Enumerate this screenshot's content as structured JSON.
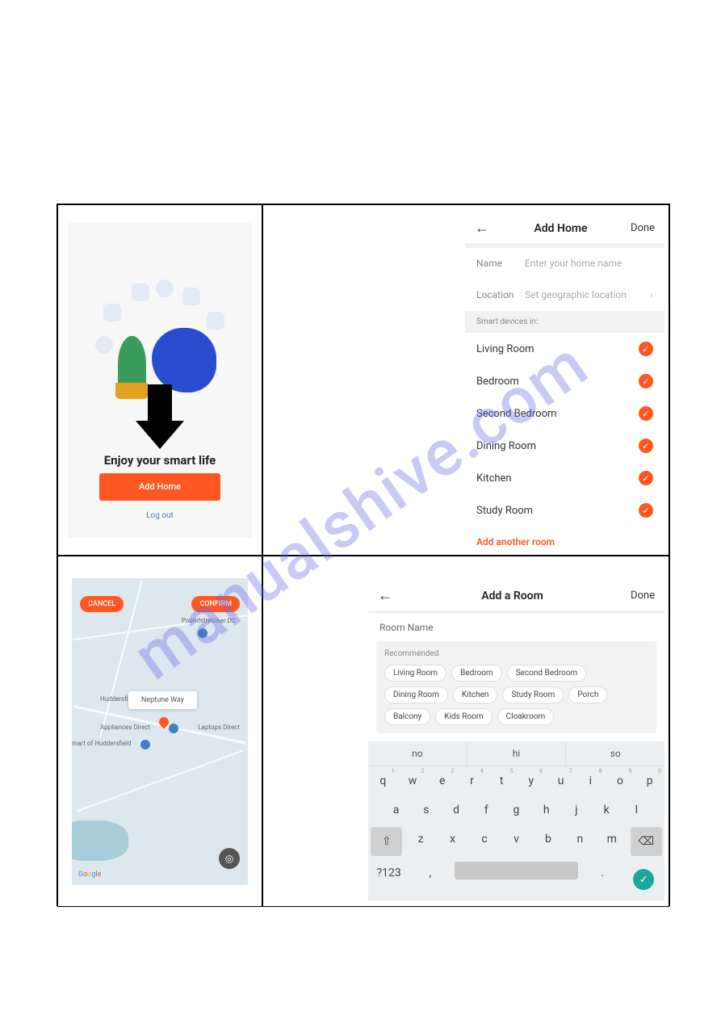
{
  "watermark": "manualshive.com",
  "screen1": {
    "tagline": "Enjoy your smart life",
    "add_home_btn": "Add Home",
    "logout": "Log out"
  },
  "screen2": {
    "title": "Add Home",
    "done": "Done",
    "name_label": "Name",
    "name_placeholder": "Enter your home name",
    "location_label": "Location",
    "location_placeholder": "Set geographic location",
    "section": "Smart devices in:",
    "rooms": [
      "Living Room",
      "Bedroom",
      "Second Bedroom",
      "Dining Room",
      "Kitchen",
      "Study Room"
    ],
    "add_link": "Add another room"
  },
  "screen3": {
    "cancel": "CANCEL",
    "confirm": "CONFIRM",
    "tooltip": "Neptune Way",
    "labels": {
      "poundstretcher": "Poundstretcher DC",
      "huddersfield": "Huddersfield",
      "appliances": "Appliances Direct",
      "laptops": "Laptops Direct",
      "mart": "mart of Huddersfield"
    },
    "logo": "Google"
  },
  "screen4": {
    "title": "Add a Room",
    "done": "Done",
    "room_name_label": "Room Name",
    "recommended": "Recommended",
    "chips": [
      "Living Room",
      "Bedroom",
      "Second Bedroom",
      "Dining Room",
      "Kitchen",
      "Study Room",
      "Porch",
      "Balcony",
      "Kids Room",
      "Cloakroom"
    ],
    "suggestions": [
      "no",
      "hi",
      "so"
    ],
    "row1": [
      "q",
      "w",
      "e",
      "r",
      "t",
      "y",
      "u",
      "i",
      "o",
      "p"
    ],
    "row1nums": [
      "1",
      "2",
      "3",
      "4",
      "5",
      "6",
      "7",
      "8",
      "9",
      "0"
    ],
    "row2": [
      "a",
      "s",
      "d",
      "f",
      "g",
      "h",
      "j",
      "k",
      "l"
    ],
    "row3": [
      "z",
      "x",
      "c",
      "v",
      "b",
      "n",
      "m"
    ],
    "sym_key": "?123",
    "comma": ",",
    "period": "."
  }
}
